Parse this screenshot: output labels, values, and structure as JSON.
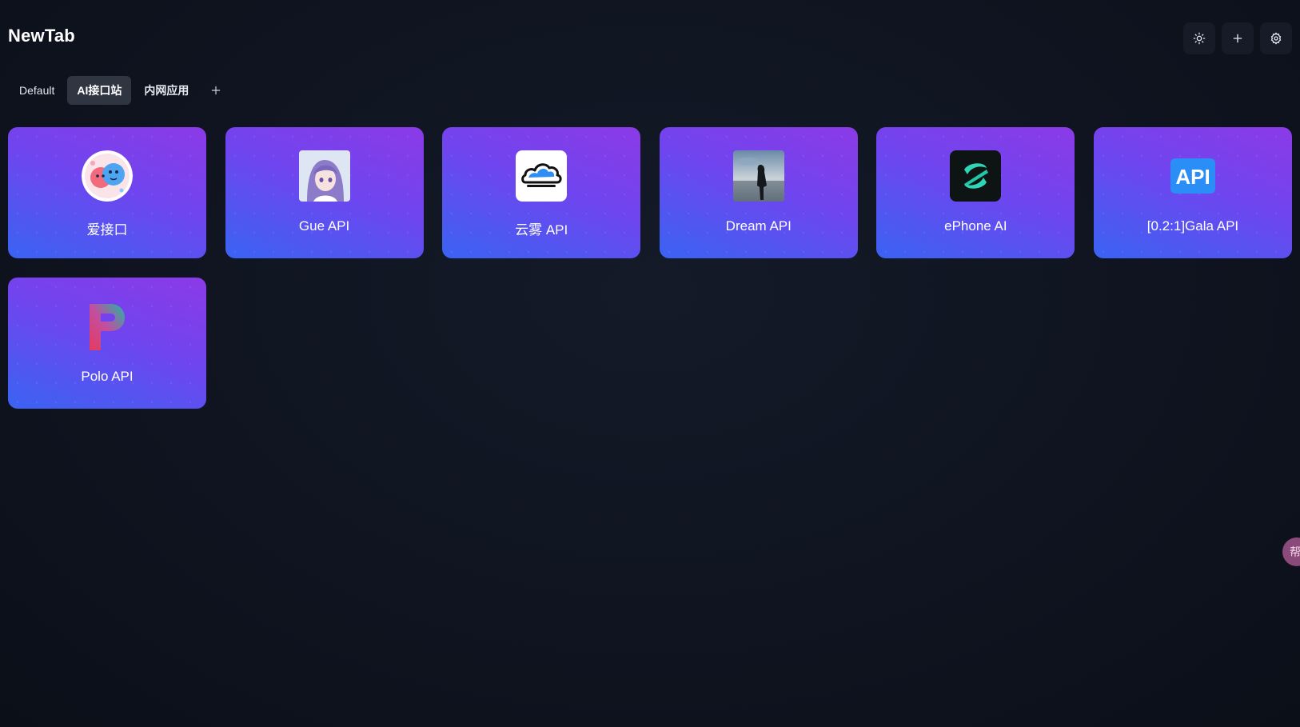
{
  "header": {
    "title": "NewTab",
    "actions": [
      {
        "name": "theme-toggle-button",
        "icon": "sun-icon"
      },
      {
        "name": "add-button",
        "icon": "plus-icon"
      },
      {
        "name": "settings-button",
        "icon": "gear-icon"
      }
    ]
  },
  "tabs": {
    "items": [
      {
        "label": "Default",
        "active": false
      },
      {
        "label": "AI接口站",
        "active": true
      },
      {
        "label": "内网应用",
        "active": false
      }
    ],
    "add_icon": "plus-icon"
  },
  "sites": [
    {
      "label": "爱接口",
      "icon": "mascot-logo-icon"
    },
    {
      "label": "Gue API",
      "icon": "anime-girl-avatar-icon"
    },
    {
      "label": "云雾 API",
      "icon": "cloud-icon"
    },
    {
      "label": "Dream API",
      "icon": "silhouette-photo-icon"
    },
    {
      "label": "ePhone AI",
      "icon": "swirl-logo-icon"
    },
    {
      "label": "[0.2:1]Gala API",
      "icon": "api-badge-icon"
    },
    {
      "label": "Polo API",
      "icon": "letter-p-logo-icon"
    }
  ],
  "api_badge_text": "API",
  "float_button": {
    "text": "帮",
    "icon": "floating-helper-icon"
  },
  "colors": {
    "background": "#0f1420",
    "card_gradient_top": "#8b3ae6",
    "card_gradient_bottom": "#3a63f2",
    "active_tab": "#2f3541"
  }
}
